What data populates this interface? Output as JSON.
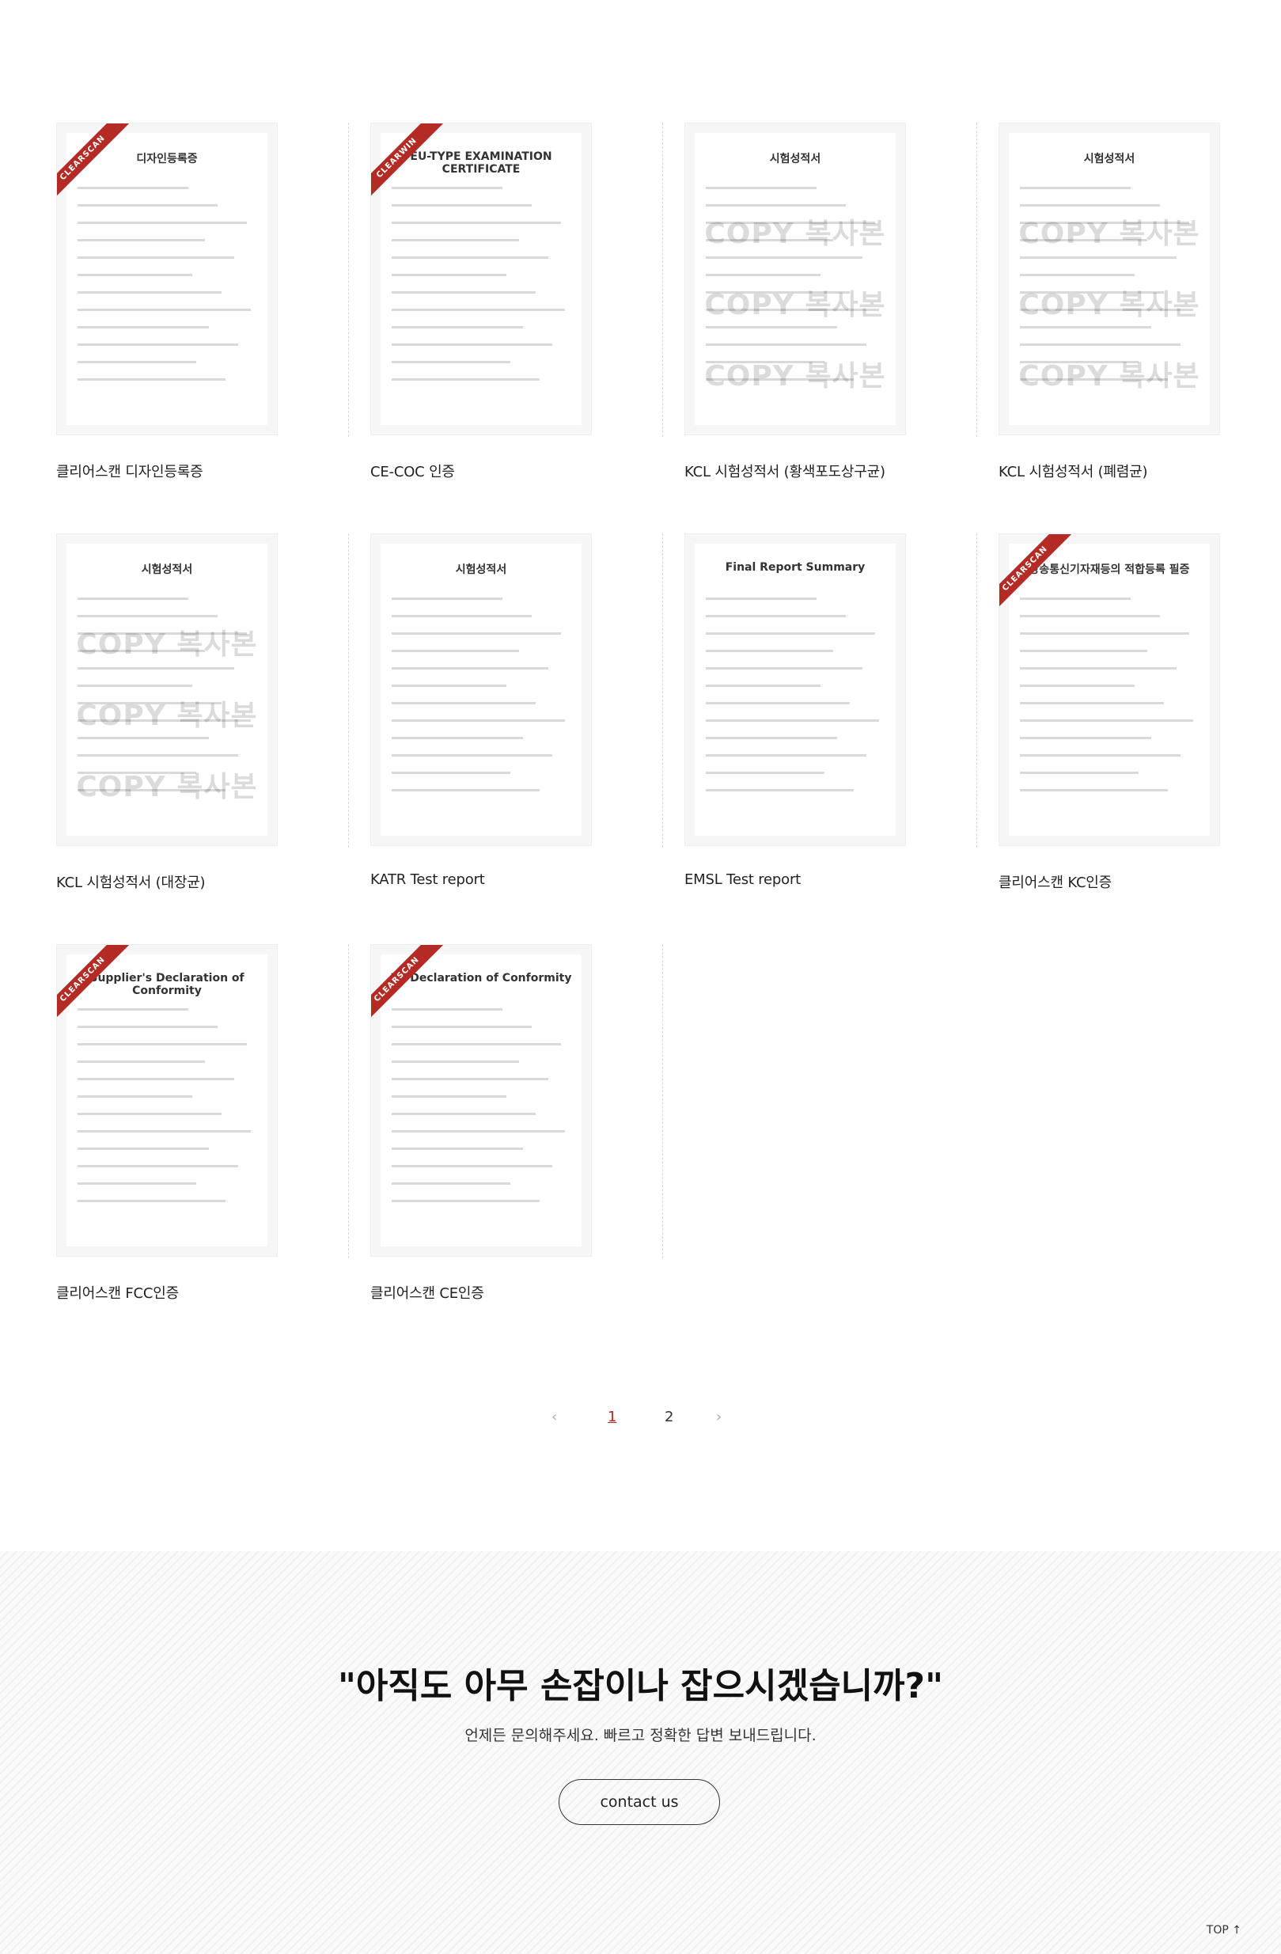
{
  "certificates": [
    {
      "caption": "클리어스캔 디자인등록증",
      "doc_title": "디자인등록증",
      "ribbon": "CLEARSCAN",
      "watermark": ""
    },
    {
      "caption": "CE-COC 인증",
      "doc_title": "EU-TYPE EXAMINATION CERTIFICATE",
      "ribbon": "CLEARWIN",
      "watermark": ""
    },
    {
      "caption": "KCL 시험성적서 (황색포도상구균)",
      "doc_title": "시험성적서",
      "ribbon": "",
      "watermark": "COPY 복사본"
    },
    {
      "caption": "KCL 시험성적서 (폐렴균)",
      "doc_title": "시험성적서",
      "ribbon": "",
      "watermark": "COPY 복사본"
    },
    {
      "caption": "KCL 시험성적서 (대장균)",
      "doc_title": "시험성적서",
      "ribbon": "",
      "watermark": "COPY 복사본"
    },
    {
      "caption": "KATR Test report",
      "doc_title": "시험성적서",
      "ribbon": "",
      "watermark": ""
    },
    {
      "caption": "EMSL Test report",
      "doc_title": "Final Report Summary",
      "ribbon": "",
      "watermark": ""
    },
    {
      "caption": "클리어스캔 KC인증",
      "doc_title": "방송통신기자재등의 적합등록 필증",
      "ribbon": "CLEARSCAN",
      "watermark": ""
    },
    {
      "caption": "클리어스캔 FCC인증",
      "doc_title": "Supplier's Declaration of Conformity",
      "ribbon": "CLEARSCAN",
      "watermark": ""
    },
    {
      "caption": "클리어스캔 CE인증",
      "doc_title": "EC Declaration of Conformity",
      "ribbon": "CLEARSCAN",
      "watermark": ""
    }
  ],
  "pagination": {
    "prev": "‹",
    "pages": [
      "1",
      "2"
    ],
    "next": "›",
    "current": "1"
  },
  "cta": {
    "headline": "\"아직도 아무 손잡이나 잡으시겠습니까?\"",
    "subtext": "언제든 문의해주세요. 빠르고 정확한 답변 보내드립니다.",
    "button": "contact us"
  },
  "top_button": "TOP ↑",
  "colors": {
    "accent": "#b32b24"
  }
}
